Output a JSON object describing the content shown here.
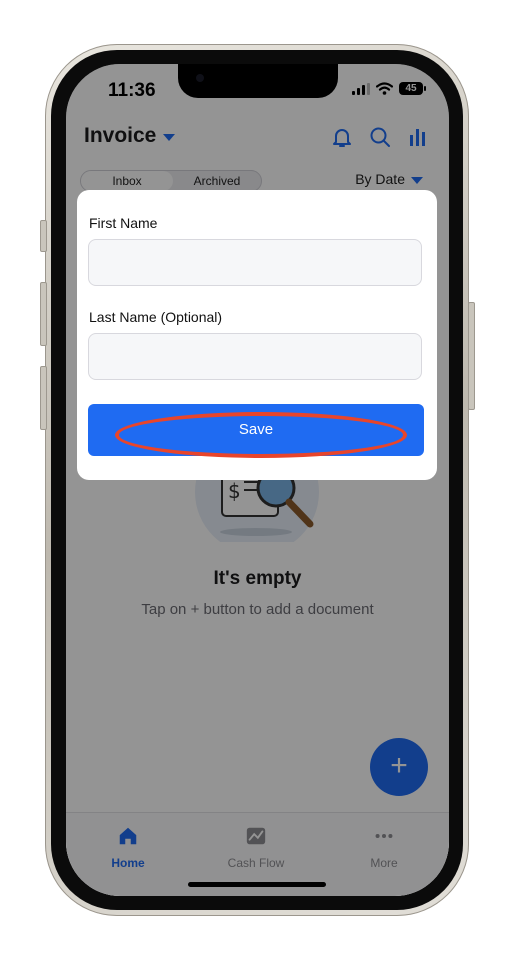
{
  "status_bar": {
    "time": "11:36",
    "battery": "45"
  },
  "app_bar": {
    "title": "Invoice"
  },
  "filter_tabs": {
    "items": [
      {
        "label": "Inbox",
        "active": true
      },
      {
        "label": "Archived",
        "active": false
      }
    ],
    "sort_label": "By Date"
  },
  "empty_state": {
    "title": "It's empty",
    "subtitle": "Tap on + button to add a document"
  },
  "fab": {
    "label": "+"
  },
  "tab_bar": {
    "items": [
      {
        "label": "Home",
        "icon": "home-icon",
        "active": true
      },
      {
        "label": "Cash Flow",
        "icon": "chart-icon",
        "active": false
      },
      {
        "label": "More",
        "icon": "more-icon",
        "active": false
      }
    ]
  },
  "modal": {
    "first_name_label": "First Name",
    "first_name_value": "",
    "last_name_label": "Last Name (Optional)",
    "last_name_value": "",
    "save_label": "Save"
  },
  "colors": {
    "accent": "#1f6bf2",
    "highlight": "#e8452b",
    "overlay": "rgba(0,0,0,0.42)"
  }
}
